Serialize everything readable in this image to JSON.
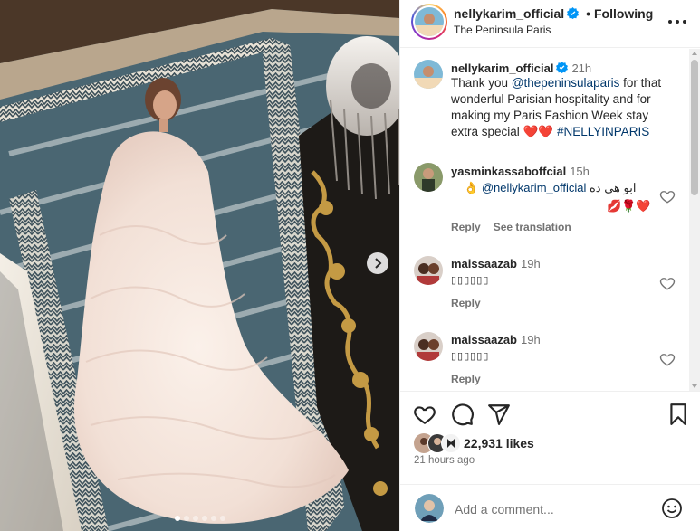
{
  "post": {
    "username": "nellykarim_official",
    "follow_separator": "•",
    "follow_status": "Following",
    "location": "The Peninsula Paris"
  },
  "caption": {
    "username": "nellykarim_official",
    "time": "21h",
    "text_before_mention": "Thank you ",
    "mention": "@thepeninsulaparis",
    "text_after_mention": " for that wonderful Parisian hospitality and for making my Paris Fashion Week stay extra special ",
    "emojis": "❤️❤️",
    "hashtag": "#NELLYINPARIS"
  },
  "comments": [
    {
      "username": "yasminkassaboffcial",
      "time": "15h",
      "text_rtl": "ابو هي ده",
      "mention": "@nellykarim_official",
      "emoji_lead": "👌",
      "emoji_trail": "💋🌹❤️",
      "reply": "Reply",
      "translate": "See translation"
    },
    {
      "username": "maissaazab",
      "time": "19h",
      "text": "▯▯▯▯▯▯",
      "reply": "Reply"
    },
    {
      "username": "maissaazab",
      "time": "19h",
      "text": "▯▯▯▯▯▯",
      "reply": "Reply"
    }
  ],
  "likes": {
    "count_text": "22,931 likes"
  },
  "timestamp": "21 hours ago",
  "add_comment": {
    "placeholder": "Add a comment..."
  },
  "carousel": {
    "total_dots": 6,
    "active_index": 0
  },
  "colors": {
    "link": "#00376b",
    "muted": "#737373",
    "heart_red": "#ed4956",
    "verified_blue": "#0095f6"
  },
  "icons": {
    "more": "more-horizontal-icon",
    "like": "heart-icon",
    "comment": "comment-icon",
    "share": "send-icon",
    "save": "bookmark-icon",
    "emoji": "smiley-icon",
    "next": "chevron-right-icon"
  }
}
